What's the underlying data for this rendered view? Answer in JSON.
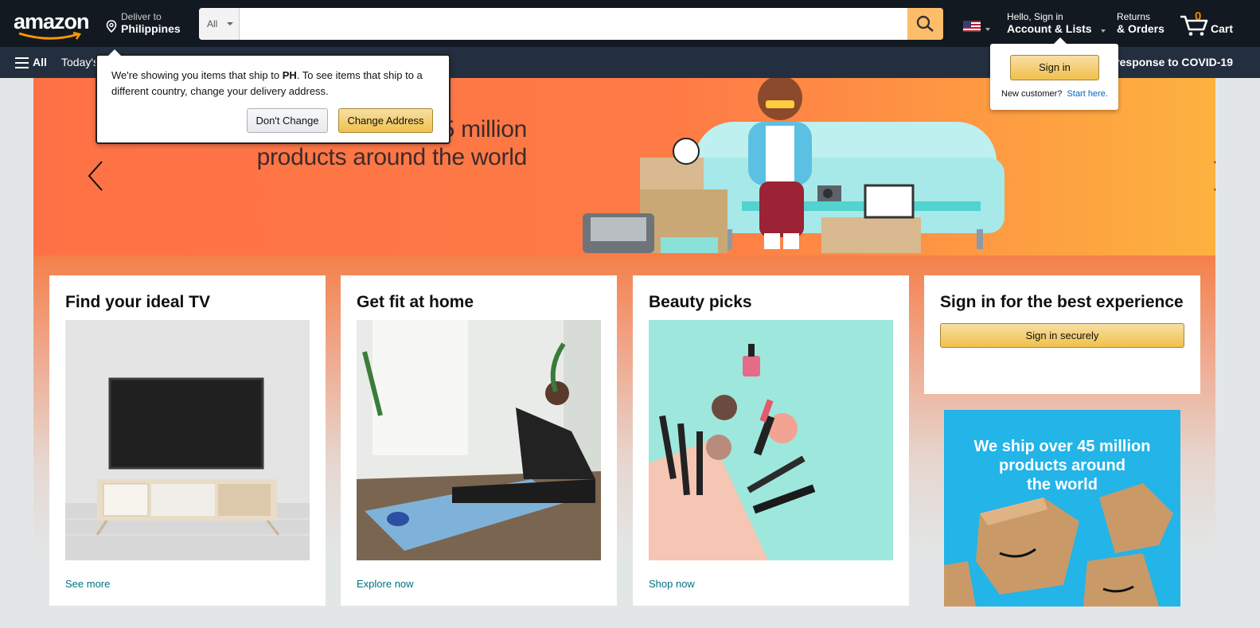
{
  "header": {
    "logo_text": "amazon",
    "deliver_to_label": "Deliver to",
    "deliver_to_country": "Philippines",
    "search_category": "All",
    "search_placeholder": "",
    "account_greeting": "Hello, Sign in",
    "account_label": "Account & Lists",
    "returns_label": "Returns",
    "orders_label": "& Orders",
    "cart_count": "0",
    "cart_label": "Cart"
  },
  "subnav": {
    "all_label": "All",
    "today_label": "Today's",
    "covid_label": "response to COVID-19"
  },
  "hero": {
    "line1": "r 45 million",
    "line2": "products around the world"
  },
  "ship_popover": {
    "message_prefix": "We're showing you items that ship to ",
    "country_code": "PH",
    "message_suffix": ". To see items that ship to a different country, change your delivery address.",
    "dont_change": "Don't Change",
    "change_address": "Change Address"
  },
  "signin_popover": {
    "button": "Sign in",
    "new_customer": "New customer?",
    "start_here": "Start here."
  },
  "cards": [
    {
      "title": "Find your ideal TV",
      "link": "See more"
    },
    {
      "title": "Get fit at home",
      "link": "Explore now"
    },
    {
      "title": "Beauty picks",
      "link": "Shop now"
    }
  ],
  "signin_card": {
    "title": "Sign in for the best experience",
    "button": "Sign in securely"
  },
  "ad": {
    "line1": "We ship over 45 million",
    "line2": "products around",
    "line3": "the world"
  },
  "colors": {
    "nav_top": "#131921",
    "nav_bottom": "#232f3e",
    "search_button": "#febd69",
    "accent_orange": "#f08804",
    "link": "#007185"
  }
}
